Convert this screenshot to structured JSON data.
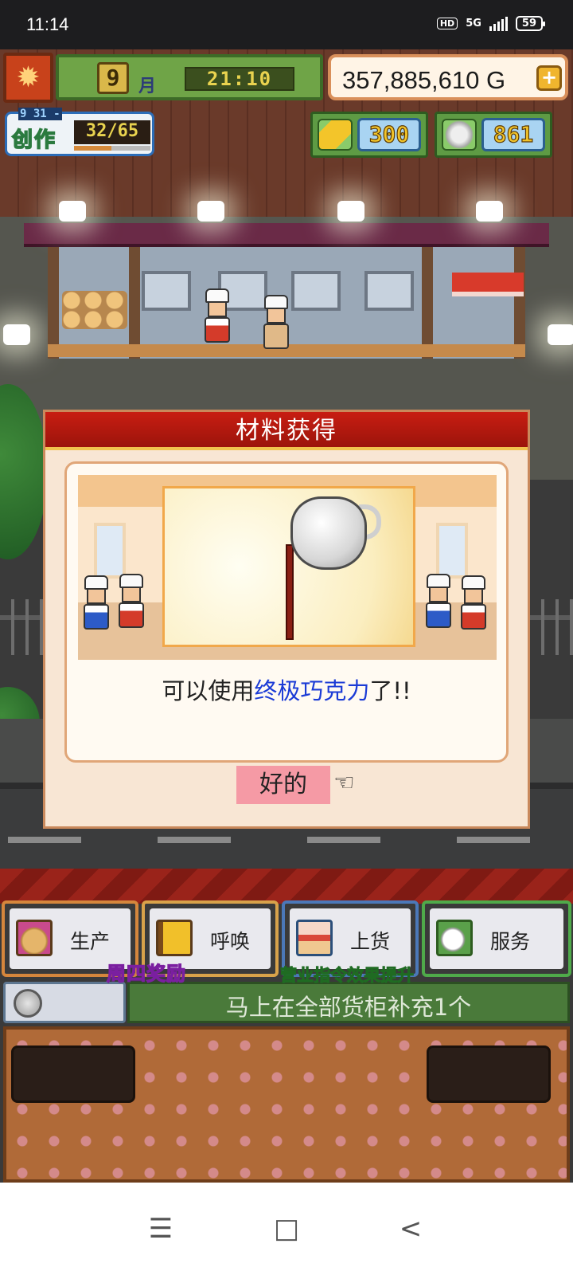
{
  "status_bar": {
    "time": "11:14",
    "hd": "HD",
    "network": "5G",
    "battery": "59"
  },
  "hud": {
    "season_icon": "maple-leaf-icon",
    "month_number": "9",
    "month_label": "月",
    "clock": "21:10",
    "money": "357,885,610 G",
    "add_money_icon": "plus-icon",
    "create": {
      "sub": "9 31 -",
      "label": "创作",
      "count": "32/65",
      "progress": 0.49
    },
    "gold_bar_count": "300",
    "coin_count": "861"
  },
  "dialog": {
    "title": "材料获得",
    "message_before": "可以使用",
    "message_highlight": "终极巧克力",
    "message_after": "了!!",
    "ok_label": "好的",
    "highlight_color": "#1b3bd6"
  },
  "menu": {
    "buttons": [
      {
        "label": "生产",
        "icon": "bread-icon"
      },
      {
        "label": "呼唤",
        "icon": "flag-icon"
      },
      {
        "label": "上货",
        "icon": "cake-icon"
      },
      {
        "label": "服务",
        "icon": "coffee-cup-icon"
      }
    ],
    "promo_left": "周四奖励",
    "promo_right": "营业指令效果提升",
    "task_text": "马上在全部货柜补充1个"
  },
  "nav": {
    "menu_icon": "☰",
    "home_icon": "□",
    "back_icon": "<"
  }
}
